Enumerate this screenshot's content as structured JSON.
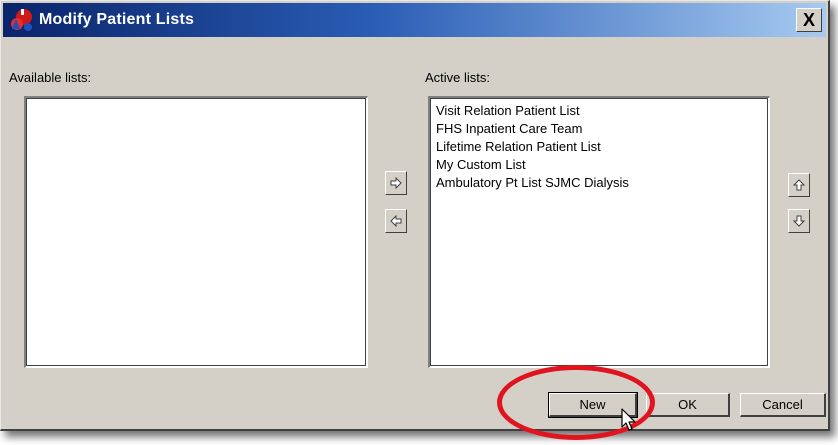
{
  "window": {
    "title": "Modify Patient Lists",
    "close_label": "X"
  },
  "available": {
    "label": "Available lists:",
    "items": []
  },
  "active": {
    "label": "Active lists:",
    "items": [
      "Visit Relation Patient List",
      "FHS Inpatient Care Team",
      "Lifetime Relation Patient List",
      "My Custom List",
      "Ambulatory Pt List SJMC Dialysis"
    ]
  },
  "buttons": {
    "new_label": "New",
    "ok_label": "OK",
    "cancel_label": "Cancel"
  },
  "icons": {
    "move_right": "arrow-right-icon",
    "move_left": "arrow-left-icon",
    "move_up": "arrow-up-icon",
    "move_down": "arrow-down-icon"
  },
  "colors": {
    "highlight": "#e0141e",
    "titlebar": "#0a246a"
  }
}
